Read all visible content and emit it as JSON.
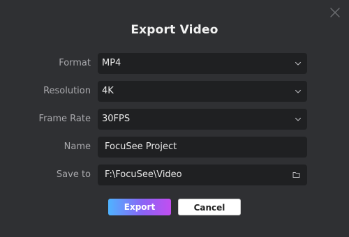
{
  "dialog": {
    "title": "Export Video"
  },
  "fields": {
    "format": {
      "label": "Format",
      "value": "MP4"
    },
    "resolution": {
      "label": "Resolution",
      "value": "4K"
    },
    "frame_rate": {
      "label": "Frame Rate",
      "value": "30FPS"
    },
    "name": {
      "label": "Name",
      "value": "FocuSee Project"
    },
    "save_to": {
      "label": "Save to",
      "value": "F:\\FocuSee\\Video"
    }
  },
  "buttons": {
    "export_label": "Export",
    "cancel_label": "Cancel"
  },
  "icons": {
    "close": "close-icon",
    "dropdown": "chevron-down-icon",
    "folder": "folder-icon"
  },
  "colors": {
    "background": "#2f3033",
    "field_background": "#1f2022",
    "label": "#a9a9ad",
    "export_gradient_start": "#4fb3ff",
    "export_gradient_end": "#c24ef0",
    "cancel_background": "#ffffff"
  }
}
